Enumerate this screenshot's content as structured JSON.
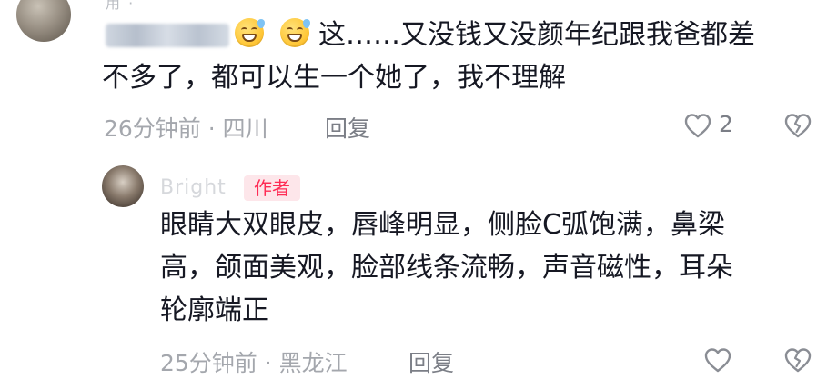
{
  "top_comment": {
    "username_fragment": "用 ·",
    "text_line1": "这……又没钱又没颜年纪跟我爸都差",
    "text_line2": "不多了，都可以生一个她了，我不理解",
    "time_location": "26分钟前 · 四川",
    "reply_label": "回复",
    "like_count": "2",
    "icons": {
      "like": "heart-icon",
      "dislike": "broken-heart-icon",
      "emoji": "sweat-smile-emoji"
    }
  },
  "reply": {
    "username": "Bright",
    "author_badge": "作者",
    "text_line1": "眼睛大双眼皮，唇峰明显，侧脸C弧饱满，鼻梁",
    "text_line2": "高，颌面美观，脸部线条流畅，声音磁性，耳朵",
    "text_line3": "轮廓端正",
    "time_location": "25分钟前 · 黑龙江",
    "reply_label": "回复"
  },
  "colors": {
    "text": "#161823",
    "meta": "#a4a7ad",
    "author_badge_text": "#fe2c55",
    "author_badge_bg": "#fde6ea"
  }
}
